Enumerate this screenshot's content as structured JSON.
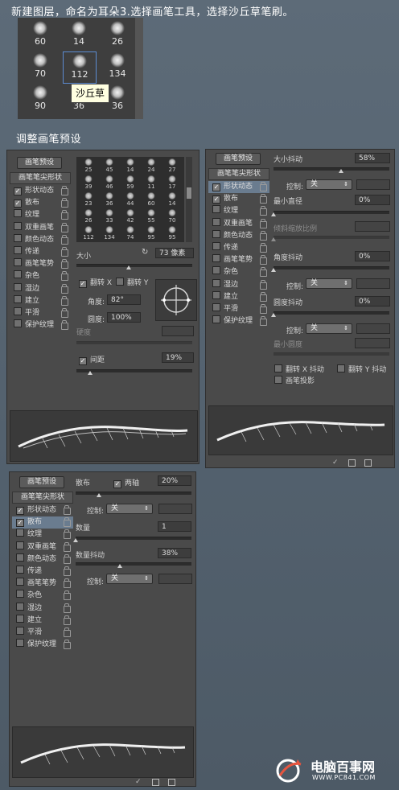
{
  "captions": {
    "step1": "新建图层，命名为耳朵3.选择画笔工具，选择沙丘草笔刷。",
    "step2": "调整画笔预设"
  },
  "picker": {
    "brushes": [
      {
        "size": "60"
      },
      {
        "size": "14"
      },
      {
        "size": "26"
      },
      {
        "size": "70"
      },
      {
        "size": "112"
      },
      {
        "size": "134"
      },
      {
        "size": "90"
      },
      {
        "size": "36"
      },
      {
        "size": "36"
      }
    ],
    "tooltip": "沙丘草"
  },
  "panel1": {
    "preset_button": "画笔预设",
    "section_header": "画笔笔尖形状",
    "options": [
      {
        "label": "形状动态",
        "checked": true
      },
      {
        "label": "散布",
        "checked": true
      },
      {
        "label": "纹理",
        "checked": false
      },
      {
        "label": "双重画笔",
        "checked": false
      },
      {
        "label": "颜色动态",
        "checked": false
      },
      {
        "label": "传递",
        "checked": false
      },
      {
        "label": "画笔笔势",
        "checked": false
      },
      {
        "label": "杂色",
        "checked": false
      },
      {
        "label": "湿边",
        "checked": false
      },
      {
        "label": "建立",
        "checked": false
      },
      {
        "label": "平滑",
        "checked": false
      },
      {
        "label": "保护纹理",
        "checked": false
      }
    ],
    "tip_grid": [
      "25",
      "45",
      "14",
      "24",
      "27",
      "39",
      "46",
      "59",
      "11",
      "17",
      "23",
      "36",
      "44",
      "60",
      "14",
      "26",
      "33",
      "42",
      "55",
      "70",
      "112",
      "134",
      "74",
      "95",
      "95"
    ],
    "size_label": "大小",
    "size_value": "73 像素",
    "flip_x_label": "翻转 X",
    "flip_y_label": "翻转 Y",
    "angle_label": "角度:",
    "angle_value": "82°",
    "roundness_label": "圆度:",
    "roundness_value": "100%",
    "hardness_label": "硬度",
    "spacing_label": "间距",
    "spacing_value": "19%",
    "size_fraction": 0.45,
    "spacing_fraction": 0.12
  },
  "panel2": {
    "preset_button": "画笔预设",
    "section_header": "画笔笔尖形状",
    "options": [
      {
        "label": "形状动态",
        "checked": true
      },
      {
        "label": "散布",
        "checked": true
      },
      {
        "label": "纹理",
        "checked": false
      },
      {
        "label": "双重画笔",
        "checked": false
      },
      {
        "label": "颜色动态",
        "checked": false
      },
      {
        "label": "传递",
        "checked": false
      },
      {
        "label": "画笔笔势",
        "checked": false
      },
      {
        "label": "杂色",
        "checked": false
      },
      {
        "label": "湿边",
        "checked": false
      },
      {
        "label": "建立",
        "checked": false
      },
      {
        "label": "平滑",
        "checked": false
      },
      {
        "label": "保护纹理",
        "checked": false
      }
    ],
    "size_jitter_label": "大小抖动",
    "size_jitter_value": "58%",
    "control_label": "控制:",
    "control_value": "关",
    "min_diameter_label": "最小直径",
    "min_diameter_value": "0%",
    "tilt_scale_label": "倾斜缩放比例",
    "angle_jitter_label": "角度抖动",
    "angle_jitter_value": "0%",
    "roundness_jitter_label": "圆度抖动",
    "roundness_jitter_value": "0%",
    "min_roundness_label": "最小圆度",
    "flip_x_jitter": "翻转 X 抖动",
    "flip_y_jitter": "翻转 Y 抖动",
    "brush_projection": "画笔投影",
    "size_jitter_fraction": 0.58
  },
  "panel3": {
    "preset_button": "画笔预设",
    "section_header": "画笔笔尖形状",
    "options": [
      {
        "label": "形状动态",
        "checked": true
      },
      {
        "label": "散布",
        "checked": true
      },
      {
        "label": "纹理",
        "checked": false
      },
      {
        "label": "双重画笔",
        "checked": false
      },
      {
        "label": "颜色动态",
        "checked": false
      },
      {
        "label": "传递",
        "checked": false
      },
      {
        "label": "画笔笔势",
        "checked": false
      },
      {
        "label": "杂色",
        "checked": false
      },
      {
        "label": "湿边",
        "checked": false
      },
      {
        "label": "建立",
        "checked": false
      },
      {
        "label": "平滑",
        "checked": false
      },
      {
        "label": "保护纹理",
        "checked": false
      }
    ],
    "scatter_label": "散布",
    "both_axes_label": "两轴",
    "scatter_value": "20%",
    "control_label": "控制:",
    "control_value": "关",
    "count_label": "数量",
    "count_value": "1",
    "count_jitter_label": "数量抖动",
    "count_jitter_value": "38%",
    "scatter_fraction": 0.2,
    "count_jitter_fraction": 0.38
  },
  "watermark": {
    "site_name": "电脑百事网",
    "site_url": "WWW.PC841.COM"
  }
}
